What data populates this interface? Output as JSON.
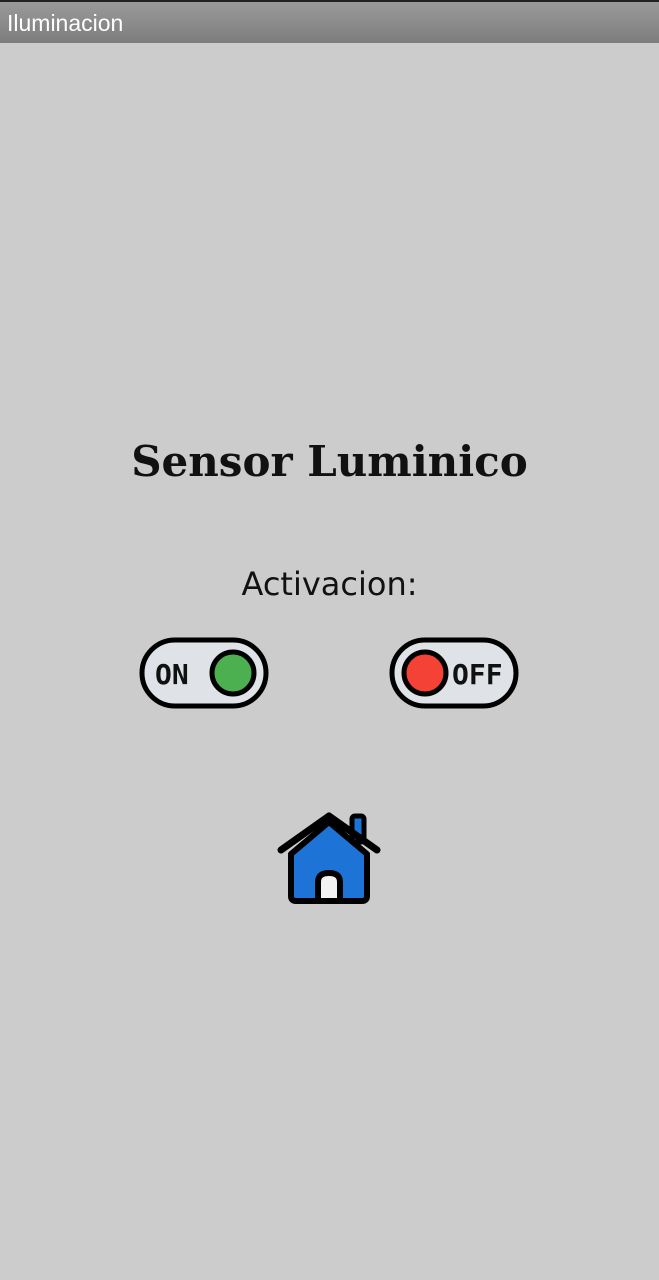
{
  "app": {
    "title": "Iluminacion"
  },
  "main": {
    "heading": "Sensor Luminico",
    "activation_label": "Activacion:",
    "toggles": {
      "on": {
        "label": "ON",
        "knob_color": "#4caf50"
      },
      "off": {
        "label": "OFF",
        "knob_color": "#f44336"
      }
    }
  },
  "icons": {
    "home": "home-icon"
  },
  "colors": {
    "background": "#cccccc",
    "titlebar": "#8a8a8a",
    "toggle_track": "#dfe3e8",
    "home_body": "#1e73d6"
  }
}
